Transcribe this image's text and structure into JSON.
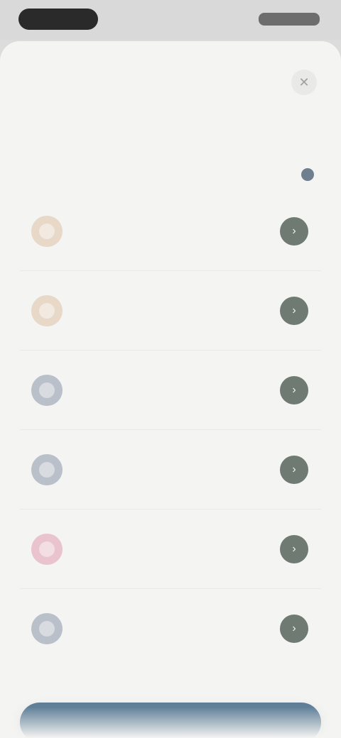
{
  "status_bar": {
    "time": "",
    "indicators": ""
  },
  "sheet": {
    "close_icon": "close-icon",
    "title": "",
    "subtitle": "",
    "header_left": "",
    "header_right": "",
    "items": [
      {
        "title": "",
        "subtitle": "",
        "icon_name": "item-icon",
        "icon_bg": "#e7d8c7",
        "action_icon": "chevron-right-icon"
      },
      {
        "title": "",
        "subtitle": "",
        "icon_name": "item-icon",
        "icon_bg": "#e7d8c7",
        "action_icon": "chevron-right-icon"
      },
      {
        "title": "",
        "subtitle": "",
        "icon_name": "item-icon",
        "icon_bg": "#b9c0c9",
        "action_icon": "chevron-right-icon"
      },
      {
        "title": "",
        "subtitle": "",
        "icon_name": "item-icon",
        "icon_bg": "#b9c0c9",
        "action_icon": "chevron-right-icon"
      },
      {
        "title": "",
        "subtitle": "",
        "icon_name": "item-icon",
        "icon_bg": "#e9c3cd",
        "action_icon": "chevron-right-icon"
      },
      {
        "title": "",
        "subtitle": "",
        "icon_name": "item-icon",
        "icon_bg": "#b9c0c9",
        "action_icon": "chevron-right-icon"
      }
    ],
    "cta_label": "",
    "colors": {
      "cta": "#5f7f98",
      "action_circle": "#6f7a73"
    }
  }
}
